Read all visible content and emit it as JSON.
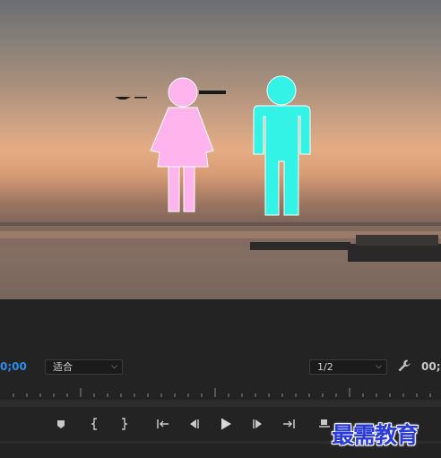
{
  "viewer": {
    "scene": "sunset-lake-video-frame",
    "figure_female_color": "#ffb4ee",
    "figure_male_color": "#33f2e6"
  },
  "controls": {
    "timecode_left": "0;00",
    "fit_dropdown": {
      "selected": "适合"
    },
    "resolution_dropdown": {
      "selected": "1/2"
    },
    "timecode_right": "00;"
  },
  "transport": [
    {
      "name": "add-marker",
      "icon": "marker-icon"
    },
    {
      "name": "mark-in",
      "icon": "mark-in-icon"
    },
    {
      "name": "mark-out",
      "icon": "mark-out-icon"
    },
    {
      "name": "go-to-in",
      "icon": "go-to-in-icon"
    },
    {
      "name": "step-back",
      "icon": "step-back-icon"
    },
    {
      "name": "play",
      "icon": "play-icon"
    },
    {
      "name": "step-forward",
      "icon": "step-forward-icon"
    },
    {
      "name": "go-to-out",
      "icon": "go-to-out-icon"
    },
    {
      "name": "lift",
      "icon": "lift-icon"
    }
  ],
  "watermark": {
    "text": "最需教育",
    "color": "#2a3bd6"
  },
  "colors": {
    "accent": "#2d8ceb",
    "panel": "#232323"
  }
}
